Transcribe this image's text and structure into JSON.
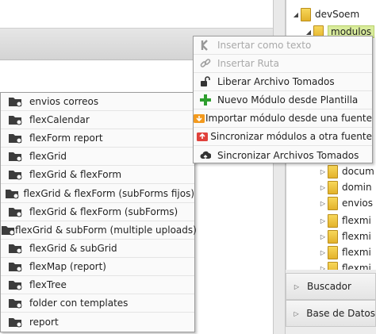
{
  "tree": {
    "root_label": "devSoem",
    "selected_label": "modulos",
    "children": [
      "docum",
      "domin",
      "envios",
      "flexmi",
      "flexmi",
      "flexmi",
      "flexmi"
    ]
  },
  "accordion": {
    "buscador": "Buscador",
    "base_datos": "Base de Datos"
  },
  "context_menu": {
    "items": [
      {
        "label": "Insertar como texto",
        "icon": "k-icon",
        "disabled": true
      },
      {
        "label": "Insertar Ruta",
        "icon": "link-icon",
        "disabled": true
      },
      {
        "label": "Liberar Archivo Tomados",
        "icon": "unlock-icon",
        "disabled": false
      },
      {
        "label": "Nuevo Módulo desde Plantilla",
        "icon": "plus-icon",
        "disabled": false
      },
      {
        "label": "Importar módulo desde una fuente",
        "icon": "import-icon",
        "disabled": false
      },
      {
        "label": "Sincronizar módulos a otra fuente",
        "icon": "sync-modules-icon",
        "disabled": false
      },
      {
        "label": "Sincronizar Archivos Tomados",
        "icon": "cloud-sync-icon",
        "disabled": false
      }
    ]
  },
  "module_menu": {
    "icon": "folder-module-icon",
    "items": [
      "envios correos",
      "flexCalendar",
      "flexForm report",
      "flexGrid",
      "flexGrid & flexForm",
      "flexGrid & flexForm (subForms fijos)",
      "flexGrid & flexForm (subForms)",
      "flexGrid & subForm (multiple uploads)",
      "flexGrid & subGrid",
      "flexMap (report)",
      "flexTree",
      "folder con templates",
      "report"
    ]
  },
  "colors": {
    "selected_node": "#d9ec9c",
    "plus_green": "#2e9e2e",
    "import_orange": "#f39a1e",
    "sync_red": "#e0413b",
    "disabled_text": "#a9a9a9"
  }
}
